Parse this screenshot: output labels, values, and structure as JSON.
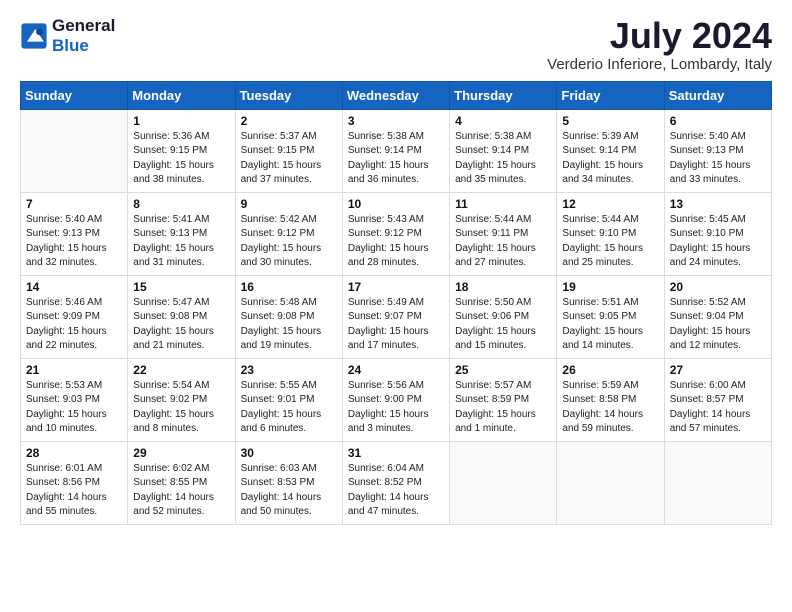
{
  "header": {
    "logo_line1": "General",
    "logo_line2": "Blue",
    "month_year": "July 2024",
    "location": "Verderio Inferiore, Lombardy, Italy"
  },
  "weekdays": [
    "Sunday",
    "Monday",
    "Tuesday",
    "Wednesday",
    "Thursday",
    "Friday",
    "Saturday"
  ],
  "weeks": [
    [
      {
        "day": "",
        "info": ""
      },
      {
        "day": "1",
        "info": "Sunrise: 5:36 AM\nSunset: 9:15 PM\nDaylight: 15 hours\nand 38 minutes."
      },
      {
        "day": "2",
        "info": "Sunrise: 5:37 AM\nSunset: 9:15 PM\nDaylight: 15 hours\nand 37 minutes."
      },
      {
        "day": "3",
        "info": "Sunrise: 5:38 AM\nSunset: 9:14 PM\nDaylight: 15 hours\nand 36 minutes."
      },
      {
        "day": "4",
        "info": "Sunrise: 5:38 AM\nSunset: 9:14 PM\nDaylight: 15 hours\nand 35 minutes."
      },
      {
        "day": "5",
        "info": "Sunrise: 5:39 AM\nSunset: 9:14 PM\nDaylight: 15 hours\nand 34 minutes."
      },
      {
        "day": "6",
        "info": "Sunrise: 5:40 AM\nSunset: 9:13 PM\nDaylight: 15 hours\nand 33 minutes."
      }
    ],
    [
      {
        "day": "7",
        "info": "Sunrise: 5:40 AM\nSunset: 9:13 PM\nDaylight: 15 hours\nand 32 minutes."
      },
      {
        "day": "8",
        "info": "Sunrise: 5:41 AM\nSunset: 9:13 PM\nDaylight: 15 hours\nand 31 minutes."
      },
      {
        "day": "9",
        "info": "Sunrise: 5:42 AM\nSunset: 9:12 PM\nDaylight: 15 hours\nand 30 minutes."
      },
      {
        "day": "10",
        "info": "Sunrise: 5:43 AM\nSunset: 9:12 PM\nDaylight: 15 hours\nand 28 minutes."
      },
      {
        "day": "11",
        "info": "Sunrise: 5:44 AM\nSunset: 9:11 PM\nDaylight: 15 hours\nand 27 minutes."
      },
      {
        "day": "12",
        "info": "Sunrise: 5:44 AM\nSunset: 9:10 PM\nDaylight: 15 hours\nand 25 minutes."
      },
      {
        "day": "13",
        "info": "Sunrise: 5:45 AM\nSunset: 9:10 PM\nDaylight: 15 hours\nand 24 minutes."
      }
    ],
    [
      {
        "day": "14",
        "info": "Sunrise: 5:46 AM\nSunset: 9:09 PM\nDaylight: 15 hours\nand 22 minutes."
      },
      {
        "day": "15",
        "info": "Sunrise: 5:47 AM\nSunset: 9:08 PM\nDaylight: 15 hours\nand 21 minutes."
      },
      {
        "day": "16",
        "info": "Sunrise: 5:48 AM\nSunset: 9:08 PM\nDaylight: 15 hours\nand 19 minutes."
      },
      {
        "day": "17",
        "info": "Sunrise: 5:49 AM\nSunset: 9:07 PM\nDaylight: 15 hours\nand 17 minutes."
      },
      {
        "day": "18",
        "info": "Sunrise: 5:50 AM\nSunset: 9:06 PM\nDaylight: 15 hours\nand 15 minutes."
      },
      {
        "day": "19",
        "info": "Sunrise: 5:51 AM\nSunset: 9:05 PM\nDaylight: 15 hours\nand 14 minutes."
      },
      {
        "day": "20",
        "info": "Sunrise: 5:52 AM\nSunset: 9:04 PM\nDaylight: 15 hours\nand 12 minutes."
      }
    ],
    [
      {
        "day": "21",
        "info": "Sunrise: 5:53 AM\nSunset: 9:03 PM\nDaylight: 15 hours\nand 10 minutes."
      },
      {
        "day": "22",
        "info": "Sunrise: 5:54 AM\nSunset: 9:02 PM\nDaylight: 15 hours\nand 8 minutes."
      },
      {
        "day": "23",
        "info": "Sunrise: 5:55 AM\nSunset: 9:01 PM\nDaylight: 15 hours\nand 6 minutes."
      },
      {
        "day": "24",
        "info": "Sunrise: 5:56 AM\nSunset: 9:00 PM\nDaylight: 15 hours\nand 3 minutes."
      },
      {
        "day": "25",
        "info": "Sunrise: 5:57 AM\nSunset: 8:59 PM\nDaylight: 15 hours\nand 1 minute."
      },
      {
        "day": "26",
        "info": "Sunrise: 5:59 AM\nSunset: 8:58 PM\nDaylight: 14 hours\nand 59 minutes."
      },
      {
        "day": "27",
        "info": "Sunrise: 6:00 AM\nSunset: 8:57 PM\nDaylight: 14 hours\nand 57 minutes."
      }
    ],
    [
      {
        "day": "28",
        "info": "Sunrise: 6:01 AM\nSunset: 8:56 PM\nDaylight: 14 hours\nand 55 minutes."
      },
      {
        "day": "29",
        "info": "Sunrise: 6:02 AM\nSunset: 8:55 PM\nDaylight: 14 hours\nand 52 minutes."
      },
      {
        "day": "30",
        "info": "Sunrise: 6:03 AM\nSunset: 8:53 PM\nDaylight: 14 hours\nand 50 minutes."
      },
      {
        "day": "31",
        "info": "Sunrise: 6:04 AM\nSunset: 8:52 PM\nDaylight: 14 hours\nand 47 minutes."
      },
      {
        "day": "",
        "info": ""
      },
      {
        "day": "",
        "info": ""
      },
      {
        "day": "",
        "info": ""
      }
    ]
  ]
}
